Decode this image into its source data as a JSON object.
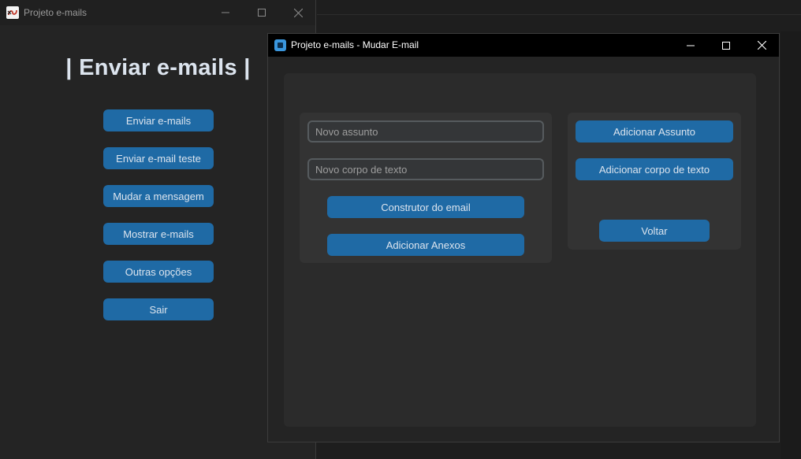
{
  "main_window": {
    "title": "Projeto e-mails",
    "heading": "|  Enviar e-mails  |",
    "buttons": [
      {
        "label": "Enviar e-mails"
      },
      {
        "label": "Enviar e-mail teste"
      },
      {
        "label": "Mudar a mensagem"
      },
      {
        "label": "Mostrar e-mails"
      },
      {
        "label": "Outras opções"
      },
      {
        "label": "Sair"
      }
    ]
  },
  "dialog_window": {
    "title": "Projeto e-mails - Mudar E-mail",
    "subject_field": {
      "placeholder": "Novo assunto"
    },
    "body_field": {
      "placeholder": "Novo corpo de texto"
    },
    "build_button": "Construtor do email",
    "attach_button": "Adicionar Anexos",
    "add_subject_button": "Adicionar Assunto",
    "add_body_button": "Adicionar corpo de texto",
    "back_button": "Voltar"
  },
  "colors": {
    "window_bg": "#242424",
    "frame_bg": "#2b2b2b",
    "panel_bg": "#333333",
    "button": "#1f6aa5",
    "text": "#dce4ee",
    "entry_border": "#565b5e"
  }
}
